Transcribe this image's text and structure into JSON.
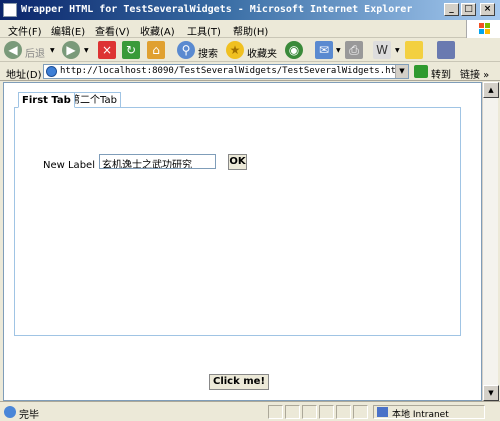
{
  "window": {
    "title": "Wrapper HTML for TestSeveralWidgets - Microsoft Internet Explorer",
    "minimize_label": "_",
    "maximize_label": "□",
    "close_label": "×"
  },
  "menu": {
    "items": [
      {
        "label": "文件(F)"
      },
      {
        "label": "编辑(E)"
      },
      {
        "label": "查看(V)"
      },
      {
        "label": "收藏(A)"
      },
      {
        "label": "工具(T)"
      },
      {
        "label": "帮助(H)"
      }
    ]
  },
  "toolbar": {
    "back_label": "后退",
    "search_label": "搜索",
    "favorites_label": "收藏夹",
    "icons": [
      "back-icon",
      "forward-icon",
      "stop-icon",
      "refresh-icon",
      "home-icon",
      "search-icon",
      "favorites-icon",
      "media-icon",
      "mail-icon",
      "print-icon",
      "edit-icon",
      "discuss-icon",
      "messenger-icon"
    ]
  },
  "address": {
    "label": "地址(D)",
    "url": "http://localhost:8090/TestSeveralWidgets/TestSeveralWidgets.html",
    "go_label": "转到",
    "links_label": "链接 »"
  },
  "page": {
    "tabs": [
      {
        "label": "First Tab",
        "selected": true
      },
      {
        "label": "第二个Tab",
        "selected": false
      }
    ],
    "new_label": "New Label",
    "text_value": "玄机逸士之武功研究",
    "ok_label": "OK",
    "click_label": "Click me!"
  },
  "status": {
    "text": "完毕",
    "zone": "本地 Intranet"
  },
  "colors": {
    "title_bar_dark": "#0a246a",
    "title_bar_light": "#a6caf0",
    "chrome": "#ece9d8",
    "tab_border": "#a0c4e4"
  }
}
